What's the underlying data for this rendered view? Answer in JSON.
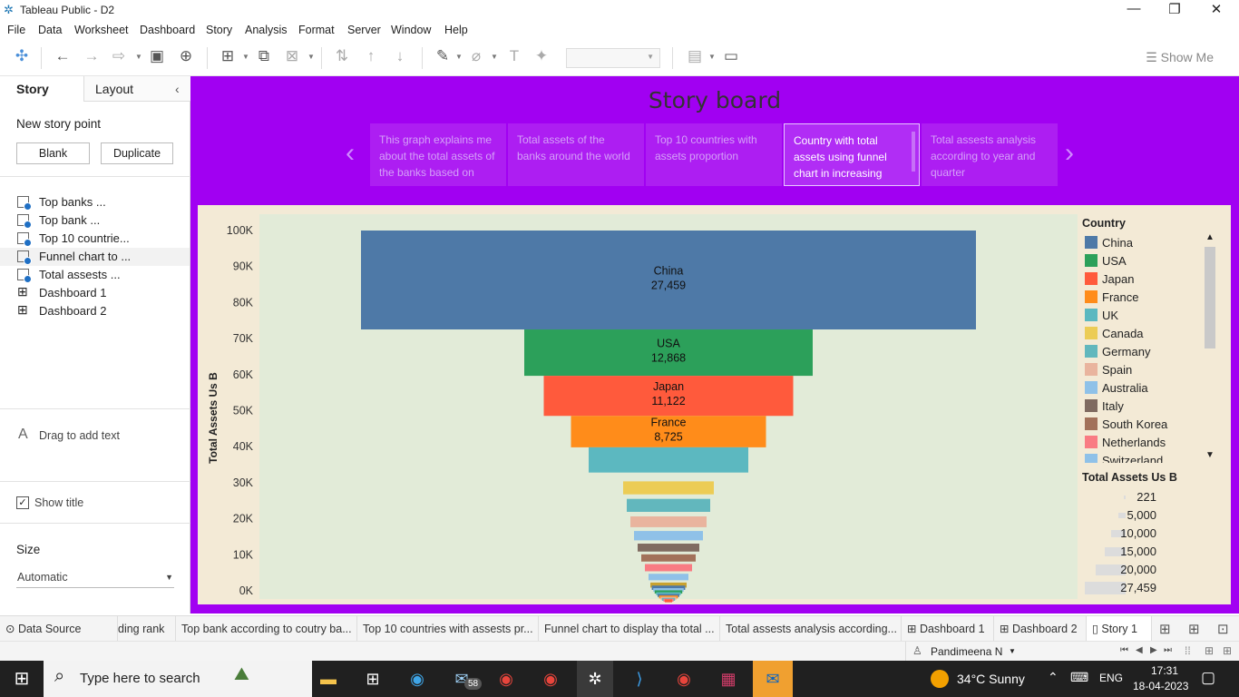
{
  "window": {
    "title": "Tableau Public - D2"
  },
  "menu": [
    "File",
    "Data",
    "Worksheet",
    "Dashboard",
    "Story",
    "Analysis",
    "Format",
    "Server",
    "Window",
    "Help"
  ],
  "toolbar": {
    "show_me": "Show Me"
  },
  "left_panel": {
    "tab_story": "Story",
    "tab_layout": "Layout",
    "new_story_point": "New story point",
    "blank_button": "Blank",
    "duplicate_button": "Duplicate",
    "sheets": [
      "Top banks ...",
      "Top bank ...",
      "Top 10 countrie...",
      "Funnel chart to ...",
      "Total assests ...",
      "Dashboard 1",
      "Dashboard 2"
    ],
    "drag_text": "Drag to add text",
    "show_title": "Show title",
    "size_label": "Size",
    "size_value": "Automatic"
  },
  "story": {
    "title": "Story board",
    "points": [
      "This graph explains me about the total assets of the banks based on",
      "Total assets of the banks around the world",
      "Top 10  countries with assets proportion",
      "Country with total assets using funnel chart in increasing",
      "Total assests analysis according to year and quarter"
    ],
    "active_index": 3
  },
  "chart_data": {
    "type": "bar",
    "subtype": "funnel",
    "ylabel": "Total Assets Us B",
    "xlabel": "",
    "ylim": [
      0,
      100000
    ],
    "yticks": [
      "0K",
      "10K",
      "20K",
      "30K",
      "40K",
      "50K",
      "60K",
      "70K",
      "80K",
      "90K",
      "100K"
    ],
    "legend_title": "Country",
    "categories": [
      "China",
      "USA",
      "Japan",
      "France",
      "UK",
      "Canada",
      "Germany",
      "Spain",
      "Australia",
      "Italy",
      "South Korea",
      "Netherlands",
      "Switzerland"
    ],
    "values": [
      27459,
      12868,
      11122,
      8725,
      7000,
      3600,
      3600,
      3000,
      2600,
      2200,
      2000,
      2000,
      1800
    ],
    "labels": [
      "China\n27,459",
      "USA\n12,868",
      "Japan\n11,122",
      "France\n8,725",
      "",
      "",
      "",
      "",
      "",
      "",
      "",
      "",
      ""
    ],
    "colors": [
      "#4e79a7",
      "#2ca05a",
      "#ff5a3c",
      "#ff8c1a",
      "#5cb8c0",
      "#eccc55",
      "#62b7bd",
      "#e9b49e",
      "#8fc1e8",
      "#7f6a60",
      "#a2715a",
      "#f97b83",
      "#8fc1e8"
    ],
    "tail_values": [
      1400,
      1200,
      1000,
      900,
      800,
      700,
      600,
      500,
      400,
      300,
      221
    ],
    "tail_colors": [
      "#c9a230",
      "#4e79a7",
      "#8fc1e8",
      "#2ca05a",
      "#5cb8c0",
      "#4e79a7",
      "#ff8c1a",
      "#e9b49e",
      "#62b7bd",
      "#f97b83",
      "#ff5a3c"
    ],
    "size_legend_title": "Total Assets Us B",
    "size_legend": [
      "221",
      "5,000",
      "10,000",
      "15,000",
      "20,000",
      "27,459"
    ],
    "grid": false,
    "legend_position": "right"
  },
  "sheet_tabs": [
    "Data Source",
    "ding rank",
    "Top bank according to coutry ba...",
    "Top 10 countries with assests pr...",
    "Funnel chart to display tha total ...",
    "Total assests analysis according...",
    "Dashboard 1",
    "Dashboard 2",
    "Story 1"
  ],
  "status": {
    "user": "Pandimeena N"
  },
  "taskbar": {
    "search_placeholder": "Type here to search",
    "weather": "34°C  Sunny",
    "lang": "ENG",
    "time": "17:31",
    "date": "18-04-2023",
    "mail_badge": "58"
  }
}
